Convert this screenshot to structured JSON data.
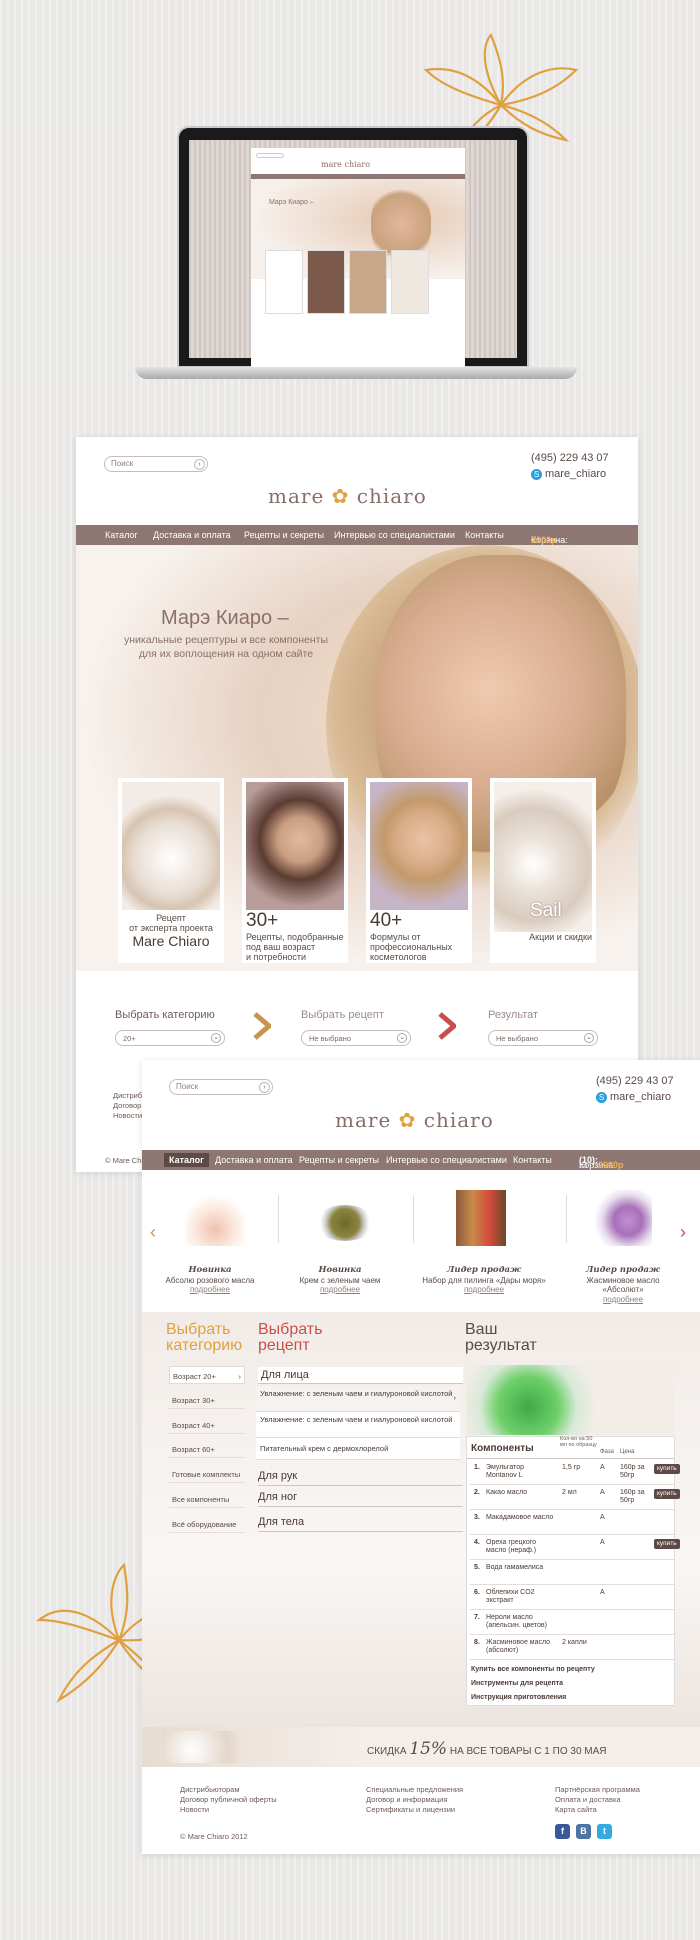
{
  "brand": {
    "logo_left": "mare",
    "logo_right": "chiaro"
  },
  "header": {
    "search_placeholder": "Поиск",
    "phone": "(495) 229 43 07",
    "skype": "mare_chiaro"
  },
  "nav": {
    "items": [
      "Каталог",
      "Доставка и оплата",
      "Рецепты и секреты",
      "Интервью со специалистами",
      "Контакты"
    ],
    "cart_label": "Корзина:",
    "cart_sum": "2000р",
    "cart_label_2": "Корзина",
    "cart_count": "(10):"
  },
  "hero": {
    "title": "Марэ Киаро –",
    "subtitle_1": "уникальные рецептуры и все компоненты",
    "subtitle_2": "для их воплощения на одном сайте",
    "cards": [
      {
        "lines": [
          "Рецепт",
          "от эксперта проекта"
        ],
        "big": "Mare Chiaro"
      },
      {
        "big": "30+",
        "lines": [
          "Рецепты, подобранные",
          "под ваш возраст",
          "и потребности"
        ]
      },
      {
        "big": "40+",
        "lines": [
          "Формулы от",
          "профессиональных",
          "косметологов"
        ]
      },
      {
        "big": "Sail",
        "lines": [
          "Акции и скидки"
        ]
      }
    ]
  },
  "steps": {
    "category": "Выбрать категорию",
    "category_value": "20+",
    "recipe": "Выбрать рецепт",
    "recipe_value": "Не выбрано",
    "result": "Результат",
    "result_value": "Не выбрано"
  },
  "footer1": {
    "links": [
      "Дистрибь",
      "Договор",
      "Новости"
    ],
    "copy": "© Mare Chi"
  },
  "products": [
    {
      "badge": "Новинка",
      "name": "Абсолю розового масла",
      "more": "подробнее"
    },
    {
      "badge": "Новинка",
      "name": "Крем с зеленым чаем",
      "more": "подробнее"
    },
    {
      "badge": "Лидер продаж",
      "name": "Набор для пилинга «Дары моря»",
      "more": "подробнее"
    },
    {
      "badge": "Лидер продаж",
      "name": "Жасминовое масло «Абсолют»",
      "more": "подробнее"
    }
  ],
  "columns": {
    "category_1": "Выбрать",
    "category_2": "категорию",
    "recipe_1": "Выбрать",
    "recipe_2": "рецепт",
    "result_1": "Ваш",
    "result_2": "результат"
  },
  "categories": [
    "Возраст 20+",
    "Возраст 30+",
    "Возраст 40+",
    "Возраст 60+",
    "Готовые комплекты",
    "Все компоненты",
    "Всё оборудование"
  ],
  "recipes": {
    "face": "Для лица",
    "face_options": [
      "Увлажнение: с зеленым чаем и гиалуроновой кислотой",
      "Увлажнение: с зеленым чаем и гиалуроновой кислотой",
      "Питательный крем с дермохлорелой"
    ],
    "hands": "Для рук",
    "legs": "Для ног",
    "body": "Для тела"
  },
  "components": {
    "title": "Компоненты",
    "col_qty": "Кол-во на 50 мл по образцу",
    "col_phase": "Фаза",
    "col_price": "Цена",
    "buy": "купить",
    "rows": [
      {
        "n": "1.",
        "name": "Эмульгатор Montanov L",
        "qty": "1,5 гр",
        "phase": "A",
        "price": "160р за 50гр",
        "buy": true
      },
      {
        "n": "2.",
        "name": "Какао масло",
        "qty": "2 мл",
        "phase": "A",
        "price": "160р за 50гр",
        "buy": true
      },
      {
        "n": "3.",
        "name": "Макадамовое масло",
        "qty": "",
        "phase": "A",
        "price": "",
        "buy": false
      },
      {
        "n": "4.",
        "name": "Ореха грецкого масло (нераф.)",
        "qty": "",
        "phase": "A",
        "price": "",
        "buy": true
      },
      {
        "n": "5.",
        "name": "Вода гамамелиса",
        "qty": "",
        "phase": "",
        "price": "",
        "buy": false
      },
      {
        "n": "6.",
        "name": "Облепихи CO2 экстракт",
        "qty": "",
        "phase": "A",
        "price": "",
        "buy": false
      },
      {
        "n": "7.",
        "name": "Нероли масло (апельсин. цветов)",
        "qty": "",
        "phase": "",
        "price": "",
        "buy": false
      },
      {
        "n": "8.",
        "name": "Жасминовое масло (абсолют)",
        "qty": "2 капли",
        "phase": "",
        "price": "",
        "buy": false
      }
    ],
    "actions": [
      "Купить все компоненты по рецепту",
      "Инструменты для рецепта",
      "Инструкция приготовления"
    ]
  },
  "promo": {
    "pre": "СКИДКА",
    "pct": "15%",
    "post": "НА ВСЕ ТОВАРЫ С 1 ПО 30 МАЯ"
  },
  "footer": {
    "col1": [
      "Дистрибьюторам",
      "Договор публичной оферты",
      "Новости"
    ],
    "col2": [
      "Специальные предложения",
      "Договор и информация",
      "Сертификаты и лицензии"
    ],
    "col3": [
      "Партнёрская программа",
      "Оплата и доставка",
      "Карта сайта"
    ],
    "copy": "© Mare Chiaro 2012",
    "social": [
      "f",
      "B",
      "t"
    ]
  },
  "colors": {
    "nav": "#8e7773",
    "accent": "#e0a040",
    "brand": "#8a6d6a"
  }
}
